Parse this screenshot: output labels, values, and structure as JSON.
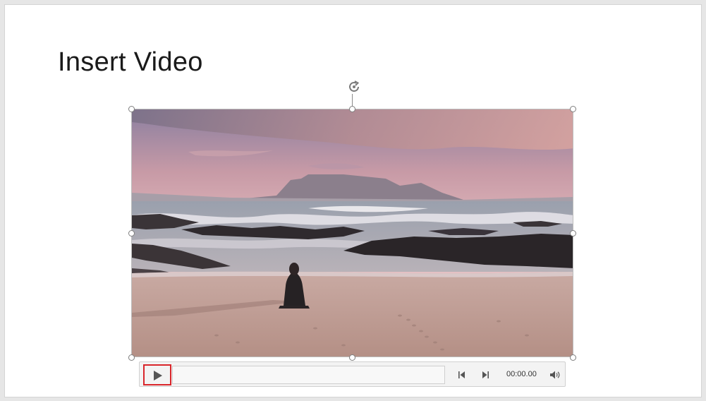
{
  "slide": {
    "title": "Insert Video"
  },
  "video": {
    "controls": {
      "play_icon": "play-icon",
      "step_back_icon": "step-back-icon",
      "step_forward_icon": "step-forward-icon",
      "volume_icon": "volume-icon",
      "time": "00:00.00",
      "progress": 0
    }
  },
  "colors": {
    "highlight_border": "#d9262b",
    "slide_background": "#ffffff",
    "window_background": "#e6e6e6"
  }
}
